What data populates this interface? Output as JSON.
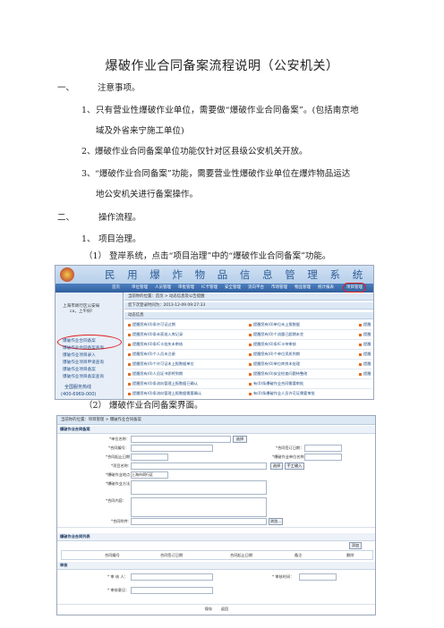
{
  "title": "爆破作业合同备案流程说明（公安机关）",
  "section1": {
    "num": "一、",
    "heading": "注意事项。",
    "items": [
      {
        "num": "1、",
        "line1": "只有营业性爆破作业单位，需要做“爆破作业合同备案”。(包括南京地",
        "line2": "域及外省来宁施工单位)"
      },
      {
        "num": "2、",
        "line1": "爆破作业合同备案单位功能仅针对区县级公安机关开放。"
      },
      {
        "num": "3、",
        "line1": "“爆破作业合同备案”功能，需要营业性爆破作业单位在爆炸物品运达",
        "line2": "地公安机关进行备案操作。"
      }
    ]
  },
  "section2": {
    "num": "二、",
    "heading": "操作流程。",
    "sub_num": "1、",
    "sub_heading": "项目治理。",
    "step1_num": "（1）",
    "step1_text": "登岸系统，点击“项目治理”中的“爆破作业合同备案”功能。",
    "step2_num": "（2）",
    "step2_text": "爆破作业合同备案界面。"
  },
  "screenshot1": {
    "system_title": "民 用 爆 炸 物 品 信 息 管 理 系 统",
    "nav": [
      "首页",
      "单位管理",
      "人员管理",
      "审批管理",
      "IC卡管理",
      "安全管理",
      "流向平台",
      "市场管理",
      "物品管理",
      "统计报表",
      "项目管理"
    ],
    "user_lines": [
      "上海市闵行区公安局",
      "ca，上午好!"
    ],
    "menu": [
      "爆破作业合同备案",
      "爆破作业合同备案查询",
      "爆破作业项目录入",
      "爆破作业项目申请查询",
      "爆破作业项目备案",
      "爆破作业项目备案查询"
    ],
    "hotline_title": "全国服务热线",
    "hotline": "(400-6969-000)",
    "breadcrumb": "当前你的位置：首页 > 动态信息及公告提醒",
    "login_time": "您下次登录时间为：2013-12-09 09:27:33",
    "notice_header": "动态信息",
    "notices_left": [
      "提醒您有(0)条许可证过期",
      "提醒您有(0)条未获准入库记录",
      "提醒您有(0)条IC卡挂失未审核",
      "提醒您有(0)个人员未注册",
      "提醒您有(0)个许可证未上报数据单位",
      "提醒您有(0)人员证书即将到期",
      "提醒您有(0)条流向管理上报数据已确认",
      "提醒您有(0)条流向管理上报数据需要确认"
    ],
    "notices_right": [
      "提醒您有(0)单位未上报数据",
      "提醒您有(0)个流量已超期未交",
      "提醒您有(0)条IC卡待审核",
      "提醒您有(0)个单位资质到期",
      "提醒您有(0)单位库房未处理",
      "提醒您有(0)安全检查问题待整改",
      "有(0)条爆破作业合同需要审批",
      "有(0)条爆破作业人员许可证需要审批"
    ],
    "notices_far": [
      "提醒",
      "提醒",
      "提醒",
      "提醒",
      "提醒",
      "提醒"
    ]
  },
  "screenshot2": {
    "breadcrumb": "当前你的位置：项目管理 > 爆破作业合同备案",
    "form_title": "爆破作业合同备案",
    "labels": {
      "a": "*单位名称：",
      "b": "*合同编号：",
      "c": "*合同起止日期：",
      "d": "*爆破作业地点：",
      "e": "*项目名称：",
      "f": "*备案日期：",
      "g": "*爆破作业方法：",
      "h": "*合同内容：",
      "i": "*合同附件：",
      "j": "*合同签订日期：",
      "k": "*爆破作业单位名称："
    },
    "select_btn": "选择",
    "manual_btn": "手工输入",
    "place_value": "上海市闵行区",
    "browse_btn": "浏览...",
    "list_title": "爆破作业合同列表",
    "add_btn": "添加",
    "grid_cols": [
      "合同编号",
      "合同签订日期",
      "合同起止日期",
      "备注",
      "删除"
    ],
    "audit_title": "审核",
    "audit_person": "* 审 核 人：",
    "audit_date": "* 审核时间：",
    "audit_opinion": "* 审核意见：",
    "save_btn": "保存",
    "back_btn": "返回"
  }
}
